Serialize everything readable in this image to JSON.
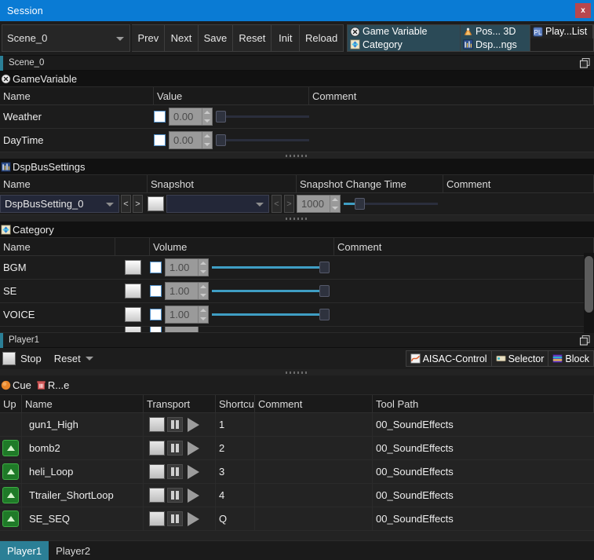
{
  "window": {
    "title": "Session",
    "close_label": "x"
  },
  "toolbar": {
    "scene_value": "Scene_0",
    "buttons": [
      "Prev",
      "Next",
      "Save",
      "Reset",
      "Init",
      "Reload"
    ],
    "toggles": [
      {
        "label": "Game Variable",
        "icon": "game-variable-icon",
        "active": true
      },
      {
        "label": "Pos... 3D",
        "icon": "pos3d-icon",
        "active": true
      },
      {
        "label": "Play...List",
        "icon": "playlist-icon",
        "active": false
      },
      {
        "label": "Category",
        "icon": "category-icon",
        "active": true
      },
      {
        "label": "Dsp...ngs",
        "icon": "dspbus-icon",
        "active": true
      }
    ]
  },
  "scene_panel": {
    "title": "Scene_0",
    "gamevariable": {
      "section_title": "GameVariable",
      "icon": "game-variable-icon",
      "columns": [
        "Name",
        "Value",
        "Comment"
      ],
      "rows": [
        {
          "name": "Weather",
          "checked": true,
          "value": "0.00",
          "slider_pct": 0,
          "comment": ""
        },
        {
          "name": "DayTime",
          "checked": true,
          "value": "0.00",
          "slider_pct": 0,
          "comment": ""
        }
      ]
    },
    "dspbussettings": {
      "section_title": "DspBusSettings",
      "icon": "dspbus-icon",
      "columns": [
        "Name",
        "Snapshot",
        "Snapshot Change Time",
        "Comment"
      ],
      "row": {
        "name": "DspBusSetting_0",
        "prev_label": "<",
        "next_label": ">",
        "snapshot_value": "",
        "snap_prev_label": "<",
        "snap_next_label": ">",
        "change_time": "1000",
        "slider_pct": 8,
        "comment": ""
      }
    },
    "category": {
      "section_title": "Category",
      "icon": "category-icon",
      "columns": [
        "Name",
        "",
        "Volume",
        "Comment"
      ],
      "rows": [
        {
          "name": "BGM",
          "value": "1.00",
          "slider_pct": 100,
          "comment": ""
        },
        {
          "name": "SE",
          "value": "1.00",
          "slider_pct": 100,
          "comment": ""
        },
        {
          "name": "VOICE",
          "value": "1.00",
          "slider_pct": 100,
          "comment": ""
        }
      ]
    }
  },
  "player_panel": {
    "title": "Player1",
    "stop_label": "Stop",
    "reset_label": "Reset",
    "right_buttons": [
      {
        "label": "AISAC-Control",
        "icon": "aisac-icon"
      },
      {
        "label": "Selector",
        "icon": "selector-icon"
      },
      {
        "label": "Block",
        "icon": "block-icon"
      }
    ],
    "cue_bar": [
      {
        "label": "Cue",
        "icon": "cue-icon"
      },
      {
        "label": "R...e",
        "icon": "trash-icon"
      }
    ],
    "columns": [
      "Up",
      "Name",
      "Transport",
      "Shortcu",
      "Comment",
      "Tool Path"
    ],
    "rows": [
      {
        "up": false,
        "name": "gun1_High",
        "shortcut": "1",
        "comment": "",
        "tool_path": "00_SoundEffects"
      },
      {
        "up": true,
        "name": "bomb2",
        "shortcut": "2",
        "comment": "",
        "tool_path": "00_SoundEffects"
      },
      {
        "up": true,
        "name": "heli_Loop",
        "shortcut": "3",
        "comment": "",
        "tool_path": "00_SoundEffects"
      },
      {
        "up": true,
        "name": "Ttrailer_ShortLoop",
        "shortcut": "4",
        "comment": "",
        "tool_path": "00_SoundEffects"
      },
      {
        "up": true,
        "name": "SE_SEQ",
        "shortcut": "Q",
        "comment": "",
        "tool_path": "00_SoundEffects"
      }
    ]
  },
  "bottom_tabs": [
    {
      "label": "Player1",
      "active": true
    },
    {
      "label": "Player2",
      "active": false
    }
  ],
  "colors": {
    "titlebar": "#0a7bd4",
    "close": "#b8474d",
    "accent": "#2b7f96",
    "slider_fill": "#3f9ec4",
    "up_arrow": "#1f7a28"
  }
}
